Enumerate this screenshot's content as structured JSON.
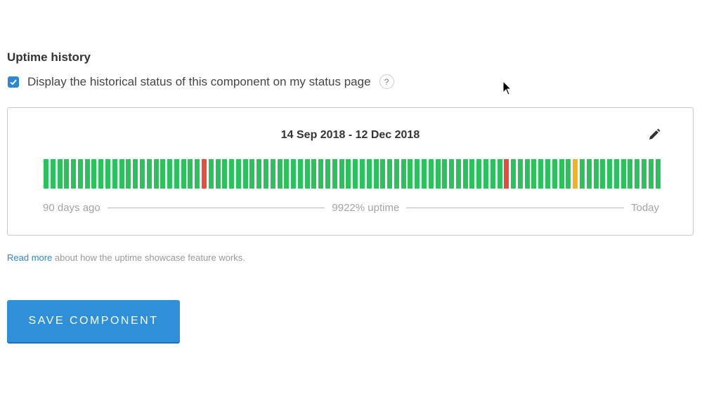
{
  "section_title": "Uptime history",
  "checkbox": {
    "label": "Display the historical status of this component on my status page",
    "checked": true,
    "help": "?"
  },
  "panel": {
    "date_range": "14 Sep 2018 - 12 Dec 2018",
    "edit_icon": "pencil-icon",
    "day_count": 90,
    "incidents": {
      "23": "major",
      "67": "major",
      "77": "partial"
    },
    "colors": {
      "operational": "#2ac35b",
      "major": "#e74c3c",
      "partial": "#f0b41c"
    },
    "legend_start": "90 days ago",
    "legend_uptime": "9922% uptime",
    "legend_end": "Today"
  },
  "note": {
    "link": "Read more",
    "text": " about how the uptime showcase feature works."
  },
  "save_label": "SAVE COMPONENT"
}
